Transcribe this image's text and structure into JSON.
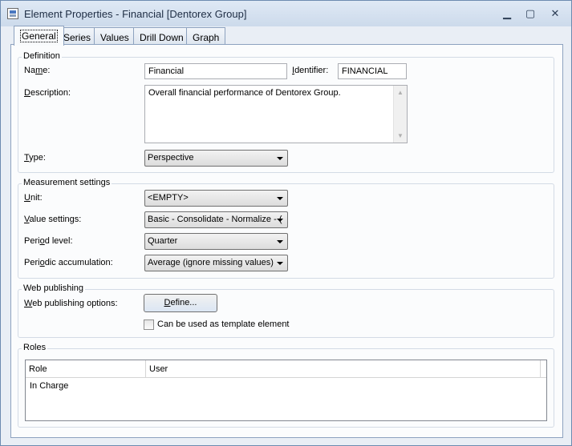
{
  "window": {
    "title": "Element Properties - Financial [Dentorex Group]",
    "minimize_glyph": "▁",
    "maximize_glyph": "▢",
    "close_glyph": "✕"
  },
  "tabs": [
    {
      "label": "General",
      "active": true
    },
    {
      "label": "Series",
      "active": false
    },
    {
      "label": "Values",
      "active": false
    },
    {
      "label": "Drill Down",
      "active": false
    },
    {
      "label": "Graph",
      "active": false
    }
  ],
  "definition": {
    "title": "Definition",
    "name_label_pre": "Na",
    "name_label_key": "m",
    "name_label_post": "e:",
    "name_value": "Financial",
    "identifier_label_key": "I",
    "identifier_label_post": "dentifier:",
    "identifier_value": "FINANCIAL",
    "description_label_key": "D",
    "description_label_post": "escription:",
    "description_value": "Overall financial performance of Dentorex Group.",
    "type_label_key": "T",
    "type_label_post": "ype:",
    "type_value": "Perspective"
  },
  "measurement": {
    "title": "Measurement settings",
    "unit_label_key": "U",
    "unit_label_post": "nit:",
    "unit_value": "<EMPTY>",
    "value_settings_label_key": "V",
    "value_settings_label_post": "alue settings:",
    "value_settings_value": "Basic - Consolidate - Normalize - (",
    "period_level_label_pre": "Peri",
    "period_level_label_key": "o",
    "period_level_label_post": "d level:",
    "period_level_value": "Quarter",
    "periodic_accum_label_pre": "Peri",
    "periodic_accum_label_key": "o",
    "periodic_accum_label_post": "dic accumulation:",
    "periodic_accum_value": "Average (ignore missing values)"
  },
  "web_publishing": {
    "title": "Web publishing",
    "options_label_key": "W",
    "options_label_post": "eb publishing options:",
    "define_button_key": "D",
    "define_button_post": "efine...",
    "template_checkbox_label": "Can be used as template element",
    "template_checked": false
  },
  "roles": {
    "title": "Roles",
    "columns": [
      "Role",
      "User"
    ],
    "rows": [
      {
        "role": "In Charge",
        "user": ""
      }
    ]
  },
  "colors": {
    "title_bar": "#ccdaeb",
    "panel_bg": "#fbfcfd",
    "border": "#8da2bf"
  }
}
